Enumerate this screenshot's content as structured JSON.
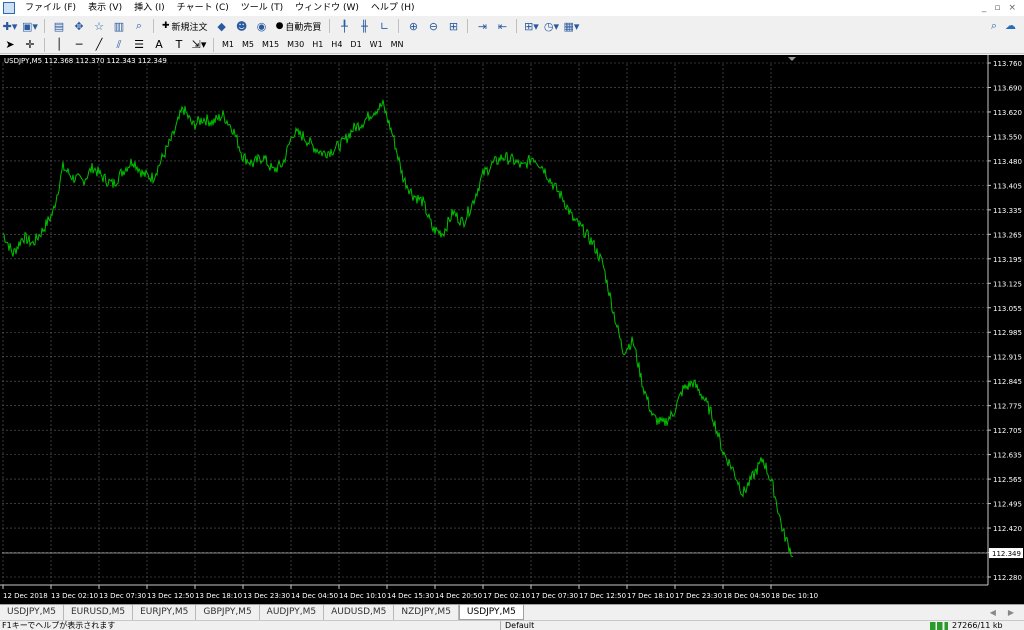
{
  "menu": {
    "items": [
      "ファイル (F)",
      "表示 (V)",
      "挿入 (I)",
      "チャート (C)",
      "ツール (T)",
      "ウィンドウ (W)",
      "ヘルプ (H)"
    ],
    "window_controls": [
      "_",
      "▫",
      "×"
    ]
  },
  "toolbar": {
    "new_order_label": "新規注文",
    "auto_trading_label": "自動売買",
    "timeframes": [
      "M1",
      "M5",
      "M15",
      "M30",
      "H1",
      "H4",
      "D1",
      "W1",
      "MN"
    ]
  },
  "chart": {
    "header": "USDJPY,M5  112.368 112.370 112.343 112.349",
    "current_price_label": "112.349",
    "line_color": "#00c000",
    "grid_color": "#606060"
  },
  "chart_data": {
    "type": "line",
    "title": "USDJPY,M5",
    "y_ticks": [
      "113.760",
      "113.690",
      "113.620",
      "113.550",
      "113.480",
      "113.405",
      "113.335",
      "113.265",
      "113.195",
      "113.125",
      "113.055",
      "112.985",
      "112.915",
      "112.845",
      "112.775",
      "112.705",
      "112.635",
      "112.565",
      "112.495",
      "112.420",
      "112.350",
      "112.280"
    ],
    "x_ticks": [
      "12 Dec 2018",
      "13 Dec 02:10",
      "13 Dec 07:30",
      "13 Dec 12:50",
      "13 Dec 18:10",
      "13 Dec 23:30",
      "14 Dec 04:50",
      "14 Dec 10:10",
      "14 Dec 15:30",
      "14 Dec 20:50",
      "17 Dec 02:10",
      "17 Dec 07:30",
      "17 Dec 12:50",
      "17 Dec 18:10",
      "17 Dec 23:30",
      "18 Dec 04:50",
      "18 Dec 10:10"
    ],
    "ylim": [
      112.28,
      113.76
    ],
    "current_price": 112.349,
    "x_bars": [
      0,
      10,
      20,
      30,
      40,
      50,
      60,
      70,
      80,
      90,
      100,
      110,
      120,
      130,
      140,
      150,
      160,
      170,
      180,
      190,
      200,
      210,
      220,
      230,
      240,
      250,
      260,
      270,
      280,
      290,
      300,
      310,
      320,
      330,
      340,
      350,
      360,
      370,
      380,
      390,
      400,
      410,
      420,
      430,
      440,
      450,
      460,
      470,
      480,
      490,
      500,
      510,
      520,
      530,
      540,
      550,
      560,
      570,
      580,
      590,
      600,
      610,
      620,
      630,
      640,
      650,
      660,
      670,
      680,
      690,
      700,
      710,
      720,
      730,
      740,
      750,
      760,
      770,
      780,
      790
    ],
    "close": [
      113.27,
      113.21,
      113.26,
      113.24,
      113.28,
      113.33,
      113.46,
      113.43,
      113.42,
      113.46,
      113.43,
      113.41,
      113.45,
      113.48,
      113.44,
      113.43,
      113.49,
      113.55,
      113.63,
      113.58,
      113.6,
      113.59,
      113.61,
      113.57,
      113.49,
      113.47,
      113.49,
      113.45,
      113.47,
      113.56,
      113.55,
      113.52,
      113.5,
      113.51,
      113.53,
      113.57,
      113.59,
      113.62,
      113.64,
      113.55,
      113.43,
      113.38,
      113.36,
      113.28,
      113.27,
      113.33,
      113.3,
      113.36,
      113.44,
      113.47,
      113.49,
      113.48,
      113.46,
      113.49,
      113.46,
      113.41,
      113.37,
      113.31,
      113.28,
      113.24,
      113.18,
      113.05,
      112.93,
      112.96,
      112.83,
      112.74,
      112.72,
      112.75,
      112.82,
      112.84,
      112.8,
      112.74,
      112.64,
      112.59,
      112.52,
      112.57,
      112.62,
      112.54,
      112.41,
      112.34
    ]
  },
  "tabs": [
    "USDJPY,M5",
    "EURUSD,M5",
    "EURJPY,M5",
    "GBPJPY,M5",
    "AUDJPY,M5",
    "AUDUSD,M5",
    "NZDJPY,M5",
    "USDJPY,M5"
  ],
  "tab_arrows": [
    "◀",
    "▶"
  ],
  "active_tab_index": 7,
  "status": {
    "help": "F1キーでヘルプが表示されます",
    "profile": "Default",
    "connection": "27266/11 kb"
  }
}
